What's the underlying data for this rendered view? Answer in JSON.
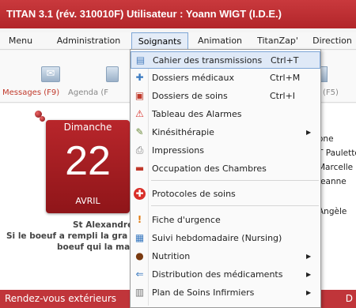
{
  "window": {
    "title": "TITAN 3.1 (rév. 310010F)   Utilisateur : Yoann WIGT (I.D.E.)"
  },
  "menubar": {
    "items": [
      "Menu",
      "Administration",
      "Soignants",
      "Animation",
      "TitanZap'",
      "Direction"
    ],
    "active": "Soignants"
  },
  "toolbar": {
    "messages_label": "Messages (F9)",
    "agenda_label": "Agenda (F",
    "right_label": "(F5)"
  },
  "calendar": {
    "day": "Dimanche",
    "number": "22",
    "month": "AVRIL"
  },
  "saint": {
    "line1": "St Alexandre",
    "line2": "Si le boeuf a rempli la gra",
    "line3": "boeuf qui la man"
  },
  "right_list": [
    "one",
    "T Paulette",
    "Marcelle",
    "Jeanne",
    "Angèle"
  ],
  "bottom": {
    "left": "Rendez-vous extérieurs",
    "right": "D"
  },
  "dropdown": {
    "items": [
      {
        "label": "Cahier des transmissions",
        "shortcut": "Ctrl+T",
        "icon": "notebook-icon",
        "color": "#4a7fbf"
      },
      {
        "label": "Dossiers médicaux",
        "shortcut": "Ctrl+M",
        "icon": "medical-folder-icon",
        "color": "#3a7ac0"
      },
      {
        "label": "Dossiers de soins",
        "shortcut": "Ctrl+I",
        "icon": "care-folder-icon",
        "color": "#c0392b"
      },
      {
        "label": "Tableau des Alarmes",
        "shortcut": "",
        "icon": "alarm-triangle-icon",
        "color": "#d9302a"
      },
      {
        "label": "Kinésithérapie",
        "shortcut": "",
        "icon": "physio-icon",
        "color": "#6b8a3a",
        "submenu": true
      },
      {
        "label": "Impressions",
        "shortcut": "",
        "icon": "printer-icon",
        "color": "#777777"
      },
      {
        "label": "Occupation des Chambres",
        "shortcut": "",
        "icon": "bed-icon",
        "color": "#c0392b"
      },
      {
        "label": "Protocoles de soins",
        "shortcut": "",
        "icon": "red-cross-icon",
        "color": "#d9302a"
      },
      {
        "label": "Fiche d'urgence",
        "shortcut": "",
        "icon": "exclamation-icon",
        "color": "#e07a10"
      },
      {
        "label": "Suivi hebdomadaire (Nursing)",
        "shortcut": "",
        "icon": "weekly-chart-icon",
        "color": "#3a7ac0"
      },
      {
        "label": "Nutrition",
        "shortcut": "",
        "icon": "nutrition-icon",
        "color": "#7a3a10",
        "submenu": true
      },
      {
        "label": "Distribution des médicaments",
        "shortcut": "",
        "icon": "medication-icon",
        "color": "#3a7ac0",
        "submenu": true
      },
      {
        "label": "Plan de Soins Infirmiers",
        "shortcut": "",
        "icon": "care-plan-icon",
        "color": "#777777",
        "submenu": true
      }
    ],
    "submenu_arrow": "▶"
  },
  "glyphs": {
    "notebook-icon": "▤",
    "medical-folder-icon": "✚",
    "care-folder-icon": "▣",
    "alarm-triangle-icon": "⚠",
    "physio-icon": "✎",
    "printer-icon": "⎙",
    "bed-icon": "▬",
    "red-cross-icon": "✚",
    "exclamation-icon": "!",
    "weekly-chart-icon": "▦",
    "nutrition-icon": "●",
    "medication-icon": "⇐",
    "care-plan-icon": "▥",
    "messages-icon": "✉"
  }
}
